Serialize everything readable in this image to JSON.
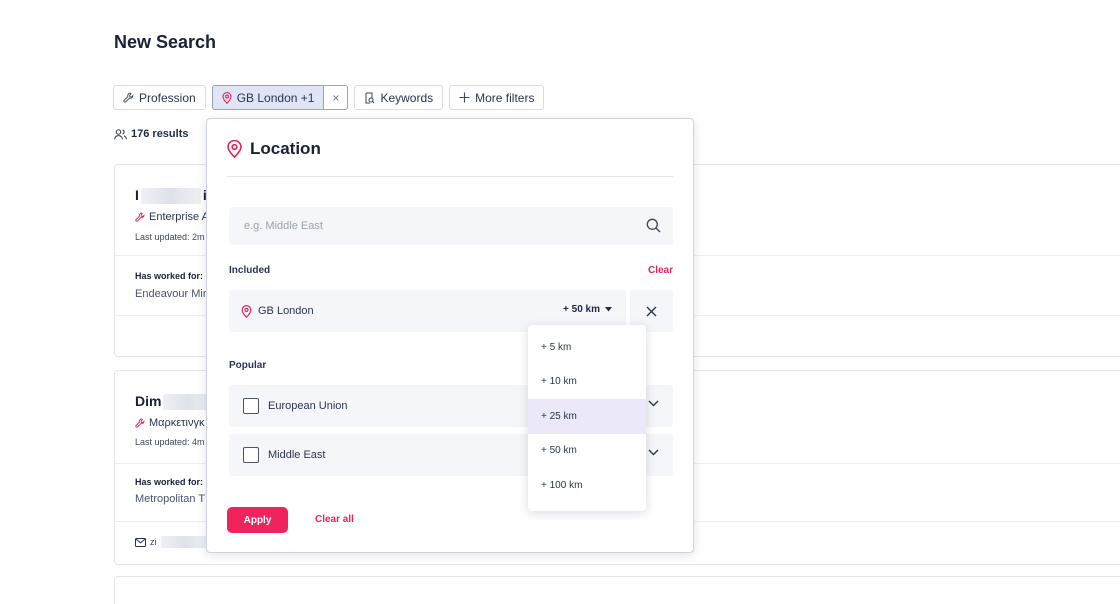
{
  "page": {
    "title": "New Search"
  },
  "filters": {
    "profession": "Profession",
    "location": "GB London +1",
    "location_clear": "×",
    "keywords": "Keywords",
    "more": "More filters"
  },
  "results": {
    "count": "176 results"
  },
  "cards": [
    {
      "name_visible_start": "I",
      "name_visible_end": "i",
      "role": "Enterprise A",
      "updated": "Last updated: 2m",
      "worked_label": "Has worked for:",
      "worked_value": "Endeavour Min"
    },
    {
      "name_visible_start": "Dim",
      "name_visible_end": "",
      "role": "Μαρκετινγκ",
      "updated": "Last updated: 4m",
      "worked_label": "Has worked for:",
      "worked_value": "Metropolitan T",
      "contact": "zi"
    }
  ],
  "location_panel": {
    "title": "Location",
    "search_placeholder": "e.g. Middle East",
    "included_label": "Included",
    "clear_label": "Clear",
    "included_location": "GB London",
    "radius_value": "+ 50 km",
    "popular_label": "Popular",
    "popular": [
      "European Union",
      "Middle East"
    ],
    "apply_label": "Apply",
    "clear_all_label": "Clear all"
  },
  "radius_options": [
    "+ 5 km",
    "+ 10 km",
    "+ 25 km",
    "+ 50 km",
    "+ 100 km"
  ],
  "radius_highlighted": "+ 25 km",
  "colors": {
    "accent": "#f0245c",
    "link": "#e0245e",
    "active_chip": "#dfe5f5",
    "highlight": "#ebe9f9"
  },
  "icons": [
    "wrench-icon",
    "map-pin-icon",
    "close-icon",
    "keyword-icon",
    "plus-icon",
    "users-icon",
    "search-icon",
    "chevron-down-icon",
    "mail-icon"
  ]
}
